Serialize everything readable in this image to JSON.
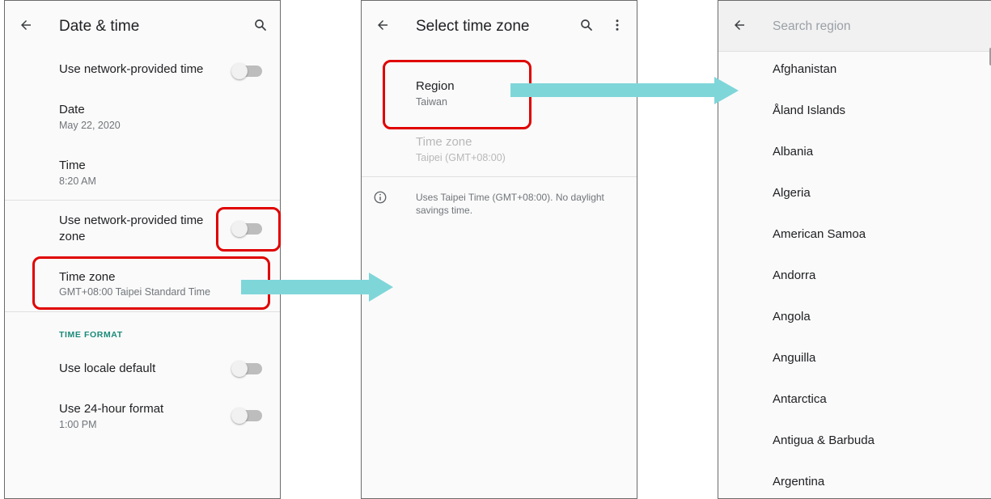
{
  "date_time": {
    "title": "Date & time",
    "items": [
      {
        "title": "Use network-provided time",
        "toggle": false
      },
      {
        "title": "Date",
        "subtitle": "May 22, 2020"
      },
      {
        "title": "Time",
        "subtitle": "8:20 AM"
      },
      {
        "title": "Use network-provided time",
        "title2": "zone",
        "toggle": false
      },
      {
        "title": "Time zone",
        "subtitle": "GMT+08:00 Taipei Standard Time"
      }
    ],
    "section": "TIME FORMAT",
    "format_items": [
      {
        "title": "Use locale default",
        "toggle": false
      },
      {
        "title": "Use 24-hour format",
        "subtitle": "1:00 PM",
        "toggle": false
      }
    ]
  },
  "select_time_zone": {
    "title": "Select time zone",
    "region": {
      "title": "Region",
      "subtitle": "Taiwan"
    },
    "time_zone": {
      "title": "Time zone",
      "subtitle": "Taipei (GMT+08:00)",
      "enabled": false
    },
    "info": {
      "line1": "Uses Taipei Time (GMT+08:00). No daylight",
      "line2": "savings time."
    }
  },
  "search_region": {
    "placeholder": "Search region",
    "regions": [
      "Afghanistan",
      "Åland Islands",
      "Albania",
      "Algeria",
      "American Samoa",
      "Andorra",
      "Angola",
      "Anguilla",
      "Antarctica",
      "Antigua & Barbuda",
      "Argentina"
    ]
  },
  "colors": {
    "highlight": "#e00000",
    "arrow": "#7fd6d9",
    "accent": "#1a8a79"
  },
  "icons": [
    "back-arrow-icon",
    "search-icon",
    "more-vert-icon",
    "info-icon"
  ]
}
